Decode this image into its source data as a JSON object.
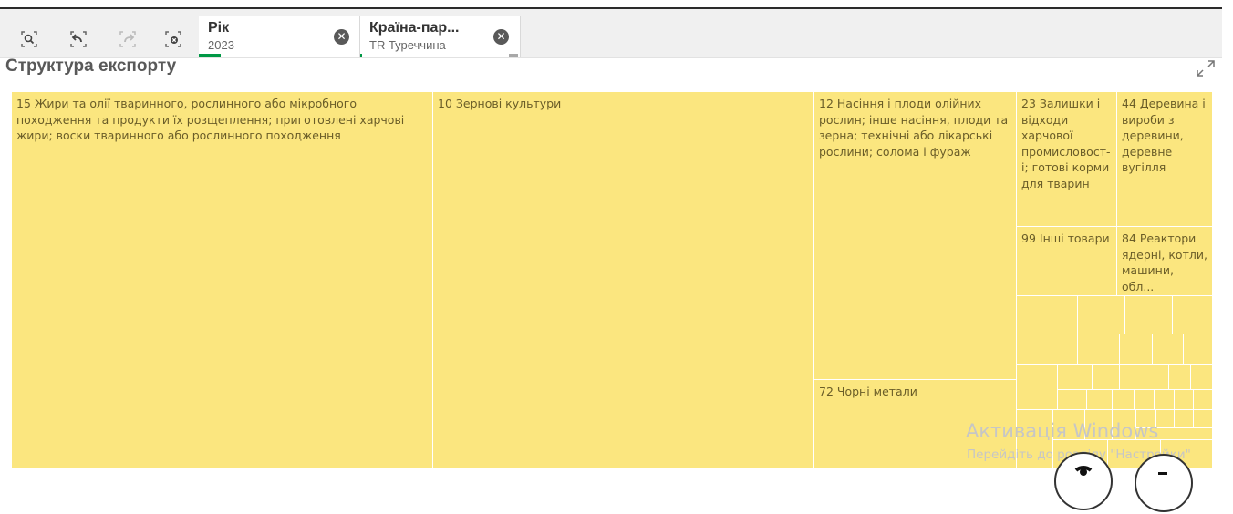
{
  "toolbar": {
    "buttons": [
      {
        "icon": "selection-search-icon"
      },
      {
        "icon": "step-back-icon"
      },
      {
        "icon": "step-forward-icon"
      },
      {
        "icon": "clear-selections-icon"
      }
    ]
  },
  "selections": [
    {
      "title": "Рік",
      "value": "2023",
      "accent": "#009845"
    },
    {
      "title": "Країна-пар...",
      "value": "TR Туреччина",
      "accent": "#009845"
    }
  ],
  "chart": {
    "title": "Структура експорту",
    "expand_icon": "expand-icon"
  },
  "chart_data": {
    "type": "treemap",
    "items": [
      {
        "label": "15 Жири та олії тваринного, рослинного або мікробного походження та продукти їх розщеплення; приготовлені харчові жири; воски тваринного або рослинного походження"
      },
      {
        "label": "10 Зернові культури"
      },
      {
        "label": "12 Насіння і плоди олійних рослин; інше насіння, плоди та зерна; технічні або лікарські рослини; солома і фураж"
      },
      {
        "label": "72 Чорні метали"
      },
      {
        "label": "23 Залишки і відходи харчової промисловост- і; готові корми для тварин"
      },
      {
        "label": "44 Деревина і вироби з деревини, деревне вугілля"
      },
      {
        "label": "99 Інші товари"
      },
      {
        "label": "84 Реактори ядерні, котли, машини, обл..."
      }
    ],
    "fill_color": "#fbe67f"
  },
  "watermark": {
    "line1": "Активація Windows",
    "line2": "Перейдіть до розділу \"Настройки\""
  }
}
